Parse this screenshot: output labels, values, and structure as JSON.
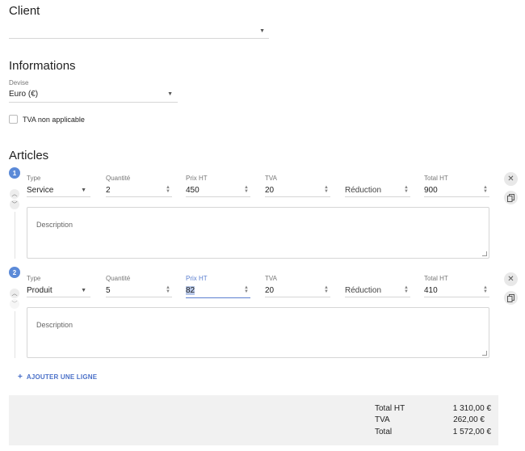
{
  "client": {
    "title": "Client",
    "select_value": ""
  },
  "informations": {
    "title": "Informations",
    "currency_label": "Devise",
    "currency_value": "Euro (€)",
    "vat_checkbox_label": "TVA non applicable",
    "vat_checked": false
  },
  "articles": {
    "title": "Articles",
    "labels": {
      "type": "Type",
      "quantity": "Quantité",
      "price": "Prix HT",
      "vat": "TVA",
      "total": "Total HT",
      "discount_placeholder": "Réduction",
      "description_placeholder": "Description"
    },
    "items": [
      {
        "number": "1",
        "type": "Service",
        "quantity": "2",
        "price": "450",
        "vat": "20",
        "total": "900"
      },
      {
        "number": "2",
        "type": "Produit",
        "quantity": "5",
        "price": "82",
        "vat": "20",
        "total": "410"
      }
    ],
    "add_line_label": "AJOUTER UNE LIGNE"
  },
  "totals": {
    "total_ht_label": "Total HT",
    "total_ht_value": "1 310,00 €",
    "tva_label": "TVA",
    "tva_value": "262,00 €",
    "total_label": "Total",
    "total_value": "1 572,00 €"
  },
  "colors": {
    "accent": "#5b8ad8",
    "link": "#4a70c8",
    "totals_bg": "#f1f1f1"
  }
}
